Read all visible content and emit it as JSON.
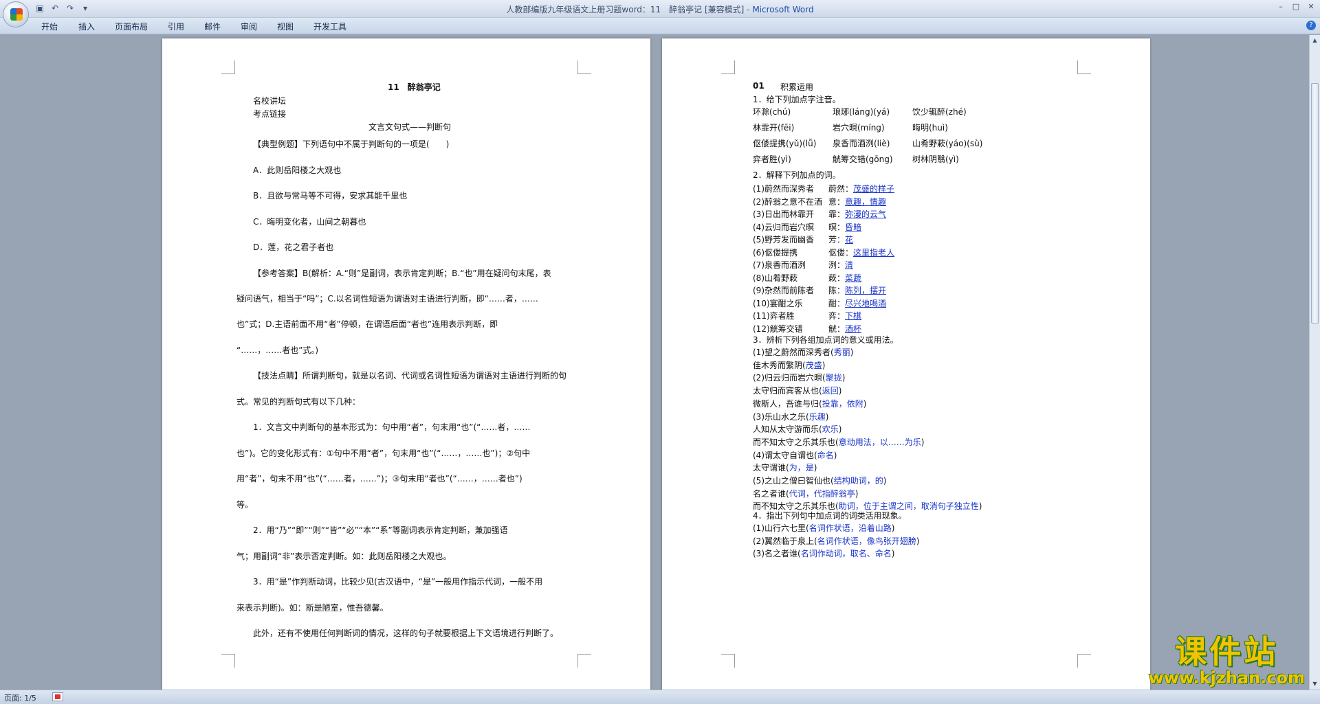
{
  "window": {
    "title": "人教部编版九年级语文上册习题word：11　醉翁亭记 [兼容模式] - ",
    "app_name": "Microsoft Word"
  },
  "ribbon": {
    "tabs": [
      "开始",
      "插入",
      "页面布局",
      "引用",
      "邮件",
      "审阅",
      "视图",
      "开发工具"
    ]
  },
  "left_page": {
    "title": "11　醉翁亭记",
    "lines": [
      "名校讲坛",
      "考点链接",
      "文言文句式——判断句",
      "【典型例题】下列语句中不属于判断句的一项是(　　)",
      "A．此则岳阳楼之大观也",
      "B．且欲与常马等不可得，安求其能千里也",
      "C．晦明变化者，山间之朝暮也",
      "D．莲，花之君子者也",
      "【参考答案】B(解析：A.“则”是副词，表示肯定判断；B.“也”用在疑问句末尾，表",
      "疑问语气，相当于“吗”；C.以名词性短语为谓语对主语进行判断，即“……者，……",
      "也”式；D.主语前面不用“者”停顿，在谓语后面“者也”连用表示判断，即",
      "“……，……者也”式。)",
      "【技法点睛】所谓判断句，就是以名词、代词或名词性短语为谓语对主语进行判断的句",
      "式。常见的判断句式有以下几种：",
      "1．文言文中判断句的基本形式为：句中用“者”，句末用“也”(“……者，……",
      "也”)。它的变化形式有：①句中不用“者”，句末用“也”(“……，……也”)；②句中",
      "用“者”，句末不用“也”(“……者，……”)；③句末用“者也”(“……，……者也”)",
      "等。",
      "2．用“乃”“即”“则”“皆”“必”“本”“系”等副词表示肯定判断，兼加强语",
      "气；用副词“非”表示否定判断。如：此则岳阳楼之大观也。",
      "3．用“是”作判断动词，比较少见(古汉语中，“是”一般用作指示代词，一般不用",
      "来表示判断)。如：斯是陋室，惟吾德馨。",
      "此外，还有不使用任何判断词的情况，这样的句子就要根据上下文语境进行判断了。"
    ]
  },
  "right_page": {
    "section_no": "01",
    "section_title": "积累运用",
    "q1": "1．给下列加点字注音。",
    "pinyin_rows": [
      [
        "环滁(chú)",
        "琅琊(láng)(yá)",
        "饮少辄醉(zhé)"
      ],
      [
        "林霏开(fēi)",
        "岩穴暝(míng)",
        "晦明(huì)"
      ],
      [
        "伛偻提携(yǔ)(lǚ)",
        "泉香而酒洌(liè)",
        "山肴野蔌(yáo)(sù)"
      ],
      [
        "弈者胜(yì)",
        "觥筹交错(gōng)",
        "树林阴翳(yì)"
      ]
    ],
    "q2": "2．解释下列加点的词。",
    "q2_items": [
      {
        "term": "(1)蔚然而深秀者",
        "word": "蔚然：",
        "meaning": "茂盛的样子"
      },
      {
        "term": "(2)醉翁之意不在酒",
        "word": "意：",
        "meaning": "意趣，情趣"
      },
      {
        "term": "(3)日出而林霏开",
        "word": "霏：",
        "meaning": "弥漫的云气"
      },
      {
        "term": "(4)云归而岩穴暝",
        "word": "暝：",
        "meaning": "昏暗"
      },
      {
        "term": "(5)野芳发而幽香",
        "word": "芳：",
        "meaning": "花"
      },
      {
        "term": "(6)伛偻提携",
        "word": "伛偻：",
        "meaning": "这里指老人"
      },
      {
        "term": "(7)泉香而酒洌",
        "word": "洌：",
        "meaning": "清"
      },
      {
        "term": "(8)山肴野蔌",
        "word": "蔌：",
        "meaning": "菜蔬"
      },
      {
        "term": "(9)杂然而前陈者",
        "word": "陈：",
        "meaning": "陈列，摆开"
      },
      {
        "term": "(10)宴酣之乐",
        "word": "酣：",
        "meaning": "尽兴地喝酒"
      },
      {
        "term": "(11)弈者胜",
        "word": "弈：",
        "meaning": "下棋"
      },
      {
        "term": "(12)觥筹交错",
        "word": "觥：",
        "meaning": "酒杯"
      }
    ],
    "q3": "3．辨析下列各组加点词的意义或用法。",
    "q3_items": [
      {
        "text": "(1)望之蔚然而深秀者(",
        "ans": "秀丽",
        "end": ")"
      },
      {
        "text": "佳木秀而繁阴(",
        "ans": "茂盛",
        "end": ")"
      },
      {
        "text": "(2)归云归而岩穴暝(",
        "ans": "聚拢",
        "end": ")"
      },
      {
        "text": "太守归而宾客从也(",
        "ans": "返回",
        "end": ")"
      },
      {
        "text": "微斯人，吾谁与归(",
        "ans": "投靠，依附",
        "end": ")"
      },
      {
        "text": "(3)乐山水之乐(",
        "ans": "乐趣",
        "end": ")"
      },
      {
        "text": "人知从太守游而乐(",
        "ans": "欢乐",
        "end": ")"
      },
      {
        "text": "而不知太守之乐其乐也(",
        "ans": "意动用法，以……为乐",
        "end": ")"
      },
      {
        "text": "(4)谓太守自谓也(",
        "ans": "命名",
        "end": ")"
      },
      {
        "text": "太守谓谁(",
        "ans": "为，是",
        "end": ")"
      },
      {
        "text": "(5)之山之僧曰智仙也(",
        "ans": "结构助词，的",
        "end": ")"
      },
      {
        "text": "名之者谁(",
        "ans": "代词，代指醉翁亭",
        "end": ")"
      },
      {
        "text": "而不知太守之乐其乐也(",
        "ans": "助词，位于主谓之间，取消句子独立性",
        "end": ")"
      }
    ],
    "q4": "4．指出下列句中加点词的词类活用现象。",
    "q4_items": [
      {
        "text": "(1)山行六七里(",
        "ans": "名词作状语，沿着山路",
        "end": ")"
      },
      {
        "text": "(2)翼然临于泉上(",
        "ans": "名词作状语，像鸟张开翅膀",
        "end": ")"
      },
      {
        "text": "(3)名之者谁(",
        "ans": "名词作动词，取名、命名",
        "end": ")"
      }
    ]
  },
  "status": {
    "page_label": "页面: 1/5"
  },
  "watermark": {
    "big": "课件站",
    "url": "www.kjzhan.com"
  }
}
